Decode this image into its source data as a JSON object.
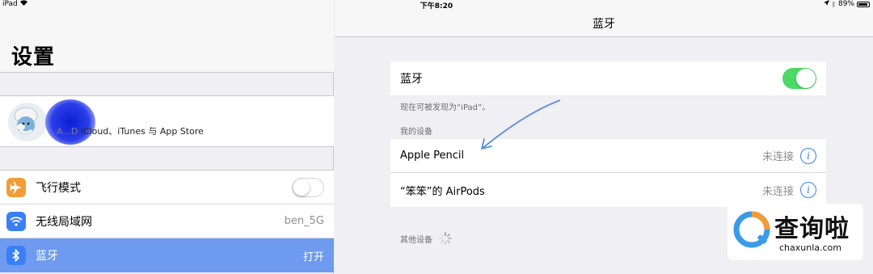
{
  "status_bar": {
    "device": "iPad",
    "time": "下午8:20",
    "battery": "89%",
    "battery_level": 0.89
  },
  "sidebar": {
    "title": "设置",
    "profile": {
      "name_obscured": "A...D",
      "subtitle": "iCloud、iTunes 与 App Store"
    },
    "items": [
      {
        "label": "飞行模式",
        "icon": "airplane-icon",
        "value": "",
        "toggle": false,
        "color": "#f29c38"
      },
      {
        "label": "无线局域网",
        "icon": "wifi-icon",
        "value": "ben_5G",
        "color": "#3b7ff5"
      },
      {
        "label": "蓝牙",
        "icon": "bluetooth-icon",
        "value": "打开",
        "selected": true,
        "color": "#3b7ff5"
      }
    ]
  },
  "detail": {
    "title": "蓝牙",
    "bluetooth_row": {
      "label": "蓝牙",
      "on": true
    },
    "discoverable_note": "现在可被发现为“iPad”。",
    "my_devices_header": "我的设备",
    "devices": [
      {
        "name": "Apple Pencil",
        "status": "未连接"
      },
      {
        "name": "“笨笨”的 AirPods",
        "status": "未连接"
      }
    ],
    "other_devices_header": "其他设备"
  },
  "watermark": {
    "cn": "查询啦",
    "url": "chaxunla.com"
  },
  "colors": {
    "accent": "#3b7ff5",
    "toggle_on": "#4cd964",
    "selected_row": "#6e9bf0"
  }
}
